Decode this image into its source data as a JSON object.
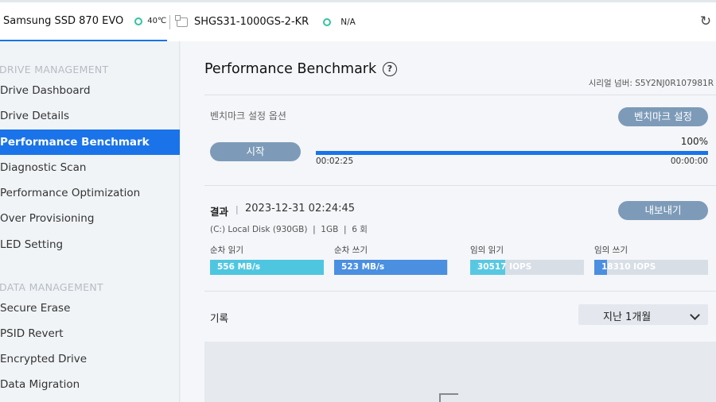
{
  "topbar": {
    "drive1_name": "Samsung SSD 870 EVO",
    "drive1_temp": "40℃",
    "drive2_name": "SHGS31-1000GS-2-KR",
    "drive2_temp": "N/A",
    "refresh_icon": "refresh-icon"
  },
  "sidebar": {
    "drive_section": "DRIVE MANAGEMENT",
    "drive_items": [
      {
        "label": "Drive Dashboard"
      },
      {
        "label": "Drive Details"
      },
      {
        "label": "Performance Benchmark"
      },
      {
        "label": "Diagnostic Scan"
      },
      {
        "label": "Performance Optimization"
      },
      {
        "label": "Over Provisioning"
      },
      {
        "label": "LED Setting"
      }
    ],
    "data_section": "DATA MANAGEMENT",
    "data_items": [
      {
        "label": "Secure Erase"
      },
      {
        "label": "PSID Revert"
      },
      {
        "label": "Encrypted Drive"
      },
      {
        "label": "Data Migration"
      }
    ]
  },
  "main": {
    "title": "Performance Benchmark",
    "help": "?",
    "serial": "시리얼 넘버: S5Y2NJ0R107981R",
    "bench_options_label": "벤치마크 설정 옵션",
    "bench_settings_button": "벤치마크 설정",
    "start_button": "시작",
    "progress_percent": "100%",
    "progress_value": 1.0,
    "elapsed": "00:02:25",
    "remaining": "00:00:00",
    "result_label": "결과",
    "result_time": "2023-12-31 02:24:45",
    "result_info": "(C:) Local Disk (930GB)  |  1GB  |  6 회",
    "export_button": "내보내기",
    "metrics": [
      {
        "label": "순차 읽기",
        "value": "556 MB/s",
        "fill": 1.0,
        "color": "#4fc6e0"
      },
      {
        "label": "순차 쓰기",
        "value": "523 MB/s",
        "fill": 0.99,
        "color": "#4a8fe0"
      },
      {
        "label": "임의 읽기",
        "value": "30517 IOPS",
        "fill": 0.31,
        "color": "#58c8e2"
      },
      {
        "label": "임의 쓰기",
        "value": "18310 IOPS",
        "fill": 0.11,
        "color": "#4a8fe0"
      }
    ],
    "history_label": "기록",
    "history_period": "지난 1개월"
  },
  "colors": {
    "accent": "#1a73e8",
    "button": "#7d9bb8",
    "temp_ok": "#33c4a0"
  }
}
